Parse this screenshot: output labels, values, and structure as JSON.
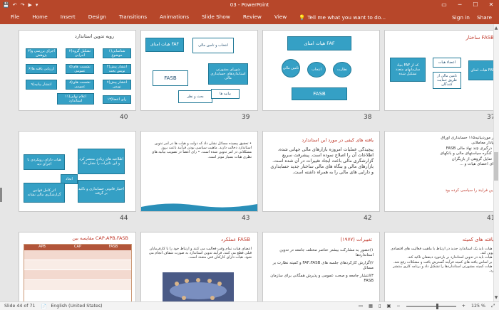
{
  "app": {
    "title": "03 - PowerPoint",
    "qat": [
      "💾",
      "↶",
      "↷",
      "▶",
      "▾"
    ],
    "window_controls": [
      "▭",
      "─",
      "☐",
      "✕"
    ]
  },
  "ribbon": {
    "tabs": [
      "File",
      "Home",
      "Insert",
      "Design",
      "Transitions",
      "Animations",
      "Slide Show",
      "Review",
      "View"
    ],
    "tell_me": "Tell me what you want to do...",
    "right": [
      "Sign in",
      "Share"
    ]
  },
  "slides": {
    "s37": {
      "num": "37",
      "title": "ساختار FASB",
      "boxes": [
        "هیات امنای FAF",
        "اعضاء هیات",
        "بنیاد FAF که از سازمانهای متعدد تشکیل شده",
        "تامین مالی از طریق حمایت کنندگان",
        "گروه مشاوره"
      ]
    },
    "s38": {
      "num": "38",
      "boxes": [
        "هیات امنای FAF",
        "نظارت",
        "انتخاب",
        "تامین مالی",
        "FASB"
      ]
    },
    "s39": {
      "num": "39",
      "boxes": [
        "هیات امنای FAF",
        "انتخاب و تامین مالی",
        "FASB",
        "شورای مشورتی استانداردهای حسابداری مالی",
        "بحث و نظر",
        "بیانیه ها"
      ]
    },
    "s40": {
      "num": "40",
      "title": "رویه تدوین استاندارد",
      "boxes": [
        "۱)شناسایی موضوع",
        "۲)تشکیل گروه اجرایی",
        "۳)اجرای بررسی و پژوهش",
        "۴)انتشار پیش نویس بحث",
        "۵)نشست های عمومی",
        "۶)ارزیابی یافته ها",
        "۷)انتشار پیش نویس",
        "۸)نشست های عمومی",
        "۹)انتشار بیانیه",
        "۱۰)اعلام هیات",
        "۱۱)اعلام نهایی استاندارد",
        "۱۲)رای اعضا"
      ]
    },
    "s41": {
      "num": "41",
      "lines": [
        "در موردبیانیه۱۱۵ حسابداری اوراق",
        "بهادار معاملاتی",
        "• درگیری چند نهاد مالی FASB",
        "• کنگره سیاستهای مالی و بانکهای",
        "• تمایل گروهی از بازیگران",
        "رای اعضای هیات و ..."
      ],
      "note": "این فرآیند را سیاسی کرده بود"
    },
    "s42": {
      "num": "42",
      "title": "یافته های کیفی در مورد این استاندارد",
      "body": "پیچیدگی عملیات امروزه بازارهای مالی جهانی شده، اطلاعات آن را اصلاح نموده است. پیشرفت سریع گزارشگری مالی باعث ایجاد تغییرات در آن شده است. بازارهای مالی و بنگاه های مالی ساختار جدید حسابداری و دارایی های مالی را به همراه داشته است."
    },
    "s43": {
      "num": "43",
      "body": "• تحقیق پیچیده مسائل نشان داد که دولت و هیات ها در امر تدوین استاندارد دخالت دارند. ماهیت سیاسی بودن فرآیند باعث بروز مشکلاتی در امر تدوین شده است. • رای اعضا در تصویب بیانیه های نظری هیات بسیار موثر است."
    },
    "s44": {
      "num": "44",
      "boxes": [
        "هیات دارای رویکردی با اجرای دید",
        "اطلاعیه های زیادی منتشر کرد و این تاثیرات را نشان داد",
        "اثر کامل قوانین گزارشگری مالی نشانه",
        "اختیار قانونی حسابداری و تاکید بر گرفته",
        "اتحاد"
      ]
    },
    "s45": {
      "num": "45",
      "title": "مقایسه بین CAP،APB،FASB",
      "cols": [
        "APB",
        "CAP",
        "FASB"
      ]
    },
    "s46": {
      "num": "46",
      "title": "عملکرد FASB",
      "body": "اعضای هیات تمام وقت فعالیت می کنند و ارتباط خود را با کارفرمایان قبلی قطع می کنند. فرآیند تدوین استاندارد به صورت شفاف انجام می شود. هیات دارای کارکنان فنی متعدد است."
    },
    "s47": {
      "num": "47",
      "title": "تغییرات (۱۹۷۷)",
      "lines": [
        "۱)حضور به مشارکت بیشتر عناصر مختلف جامعه در تدوین استانداردها",
        "۲)گزارش کارکردهای جلسه های FAF،FASB و کمیته نظارت بر مسائل",
        "۳)انتشار جامعه و صحت عمومی و پذیرش همگانی برای سازمان FASB"
      ]
    },
    "s48": {
      "num": "48",
      "title": "یافته های کمیته",
      "lines": [
        "• هیات باید یک استاندارد جدید در ارتباط با ماهیت فعالیت های اقتصادی تدوین کند.",
        "• هیات باید در تدوین استاندارد بر بازخورد ذینفعان تاکید کند.",
        "• بر اساس یافته های کمیته فرآیند گسترش یافت و مشکلات رفع شد.",
        "• هیات کمیته مشورتی استانداردها را تشکیل داد و برنامه کاری منتشر کرد."
      ]
    }
  },
  "status": {
    "slide": "Slide 44 of 71",
    "lang": "English (United States)",
    "zoom": "125 %"
  }
}
